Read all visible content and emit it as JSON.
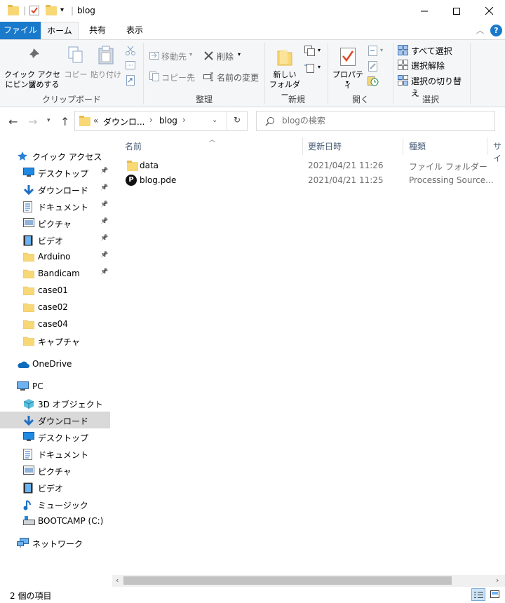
{
  "window": {
    "title": "blog"
  },
  "ribbon_tabs": {
    "file": "ファイル",
    "home": "ホーム",
    "share": "共有",
    "view": "表示"
  },
  "ribbon": {
    "clipboard": {
      "pin_line1": "クイック アクセス",
      "pin_line2": "にピン留めする",
      "copy": "コピー",
      "paste": "貼り付け",
      "label": "クリップボード"
    },
    "organize": {
      "move_to": "移動先",
      "copy_to": "コピー先",
      "delete": "削除",
      "rename": "名前の変更",
      "label": "整理"
    },
    "new": {
      "new_folder_line1": "新しい",
      "new_folder_line2": "フォルダー",
      "label": "新規"
    },
    "open": {
      "properties": "プロパティ",
      "label": "開く"
    },
    "select": {
      "select_all": "すべて選択",
      "select_none": "選択解除",
      "invert": "選択の切り替え",
      "label": "選択"
    }
  },
  "address": {
    "overflow": "«",
    "crumbs": [
      "ダウンロ...",
      "blog"
    ],
    "search_placeholder": "blogの検索"
  },
  "nav": {
    "quick_access": "クイック アクセス",
    "quick_items": [
      {
        "label": "デスクトップ",
        "icon": "desktop-icon",
        "pinned": true
      },
      {
        "label": "ダウンロード",
        "icon": "download-icon",
        "pinned": true
      },
      {
        "label": "ドキュメント",
        "icon": "document-icon",
        "pinned": true
      },
      {
        "label": "ピクチャ",
        "icon": "pictures-icon",
        "pinned": true
      },
      {
        "label": "ビデオ",
        "icon": "video-icon",
        "pinned": true
      },
      {
        "label": "Arduino",
        "icon": "folder-icon",
        "pinned": true
      },
      {
        "label": "Bandicam",
        "icon": "folder-icon",
        "pinned": true
      },
      {
        "label": "case01",
        "icon": "folder-icon",
        "pinned": false
      },
      {
        "label": "case02",
        "icon": "folder-icon",
        "pinned": false
      },
      {
        "label": "case04",
        "icon": "folder-icon",
        "pinned": false
      },
      {
        "label": "キャプチャ",
        "icon": "folder-icon",
        "pinned": false
      }
    ],
    "onedrive": "OneDrive",
    "pc": "PC",
    "pc_items": [
      {
        "label": "3D オブジェクト",
        "icon": "3d-objects-icon"
      },
      {
        "label": "ダウンロード",
        "icon": "download-icon",
        "selected": true
      },
      {
        "label": "デスクトップ",
        "icon": "desktop-icon"
      },
      {
        "label": "ドキュメント",
        "icon": "document-icon"
      },
      {
        "label": "ピクチャ",
        "icon": "pictures-icon"
      },
      {
        "label": "ビデオ",
        "icon": "video-icon"
      },
      {
        "label": "ミュージック",
        "icon": "music-icon"
      },
      {
        "label": "BOOTCAMP (C:)",
        "icon": "drive-icon"
      }
    ],
    "network": "ネットワーク"
  },
  "columns": {
    "name": "名前",
    "date": "更新日時",
    "type": "種類",
    "size": "サイ"
  },
  "files": [
    {
      "name": "data",
      "date": "2021/04/21 11:26",
      "type": "ファイル フォルダー",
      "icon": "folder-icon"
    },
    {
      "name": "blog.pde",
      "date": "2021/04/21 11:25",
      "type": "Processing Source...",
      "icon": "processing-file-icon"
    }
  ],
  "status": {
    "item_count": "2 個の項目"
  },
  "colors": {
    "accent": "#1979ca",
    "folder": "#f8d775",
    "selected": "#d9d9d9"
  }
}
